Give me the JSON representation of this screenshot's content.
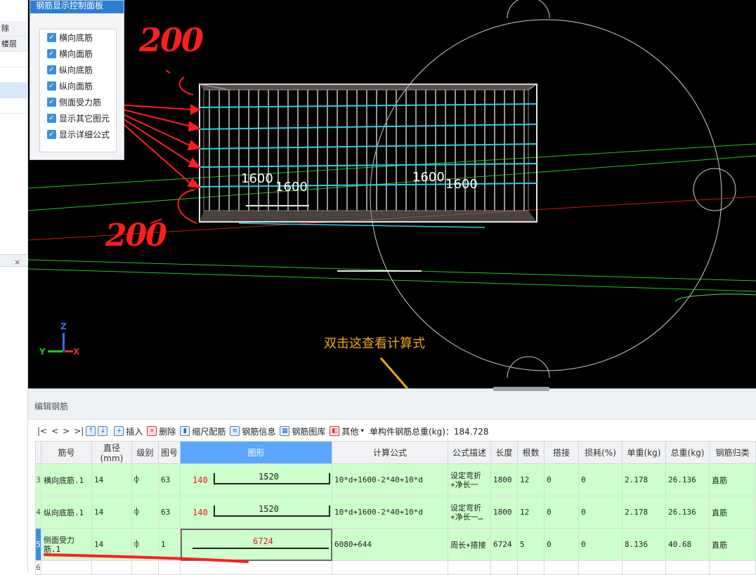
{
  "left_stub": {
    "rows": [
      "除",
      "楼层",
      "",
      "",
      "",
      ""
    ],
    "close_glyph": "×"
  },
  "control_panel": {
    "title": "钢筋显示控制面板",
    "items": [
      "横向底筋",
      "横向面筋",
      "纵向底筋",
      "纵向面筋",
      "侧面受力筋",
      "显示其它图元",
      "显示详细公式"
    ],
    "check_glyph": "✓"
  },
  "viewport": {
    "dim_labels": [
      "1600",
      "1600",
      "1600",
      "1600"
    ],
    "axes": {
      "z": "Z",
      "y": "Y",
      "x": "X"
    },
    "handwritten_top": "200",
    "handwritten_bottom": "200",
    "annotation": "双击这查看计算式"
  },
  "edit_panel": {
    "title": "编辑钢筋",
    "toolbar": {
      "nav": [
        "|<",
        "<",
        ">",
        ">|"
      ],
      "buttons": [
        "插入",
        "删除",
        "缩尺配筋",
        "钢筋信息",
        "钢筋图库",
        "其他"
      ],
      "dropdown_glyph": "▾",
      "total_weight": "单构件钢筋总重(kg)：184.728"
    },
    "columns": [
      "筋号",
      "直径(mm)",
      "级别",
      "图号",
      "图形",
      "计算公式",
      "公式描述",
      "长度",
      "根数",
      "搭接",
      "损耗(%)",
      "单重(kg)",
      "总重(kg)",
      "钢筋归类"
    ],
    "rows": [
      {
        "num": "3",
        "name": "横向底筋.1",
        "dia": "14",
        "grade": "⌽",
        "fig": "63",
        "shape_left": "140",
        "shape_mid": "1520",
        "formula": "10*d+1600-2*40+10*d",
        "desc": "设定弯折+净长一",
        "length": "1800",
        "count": "12",
        "lap": "0",
        "loss": "0",
        "unit_wt": "2.178",
        "total_wt": "26.136",
        "category": "直筋"
      },
      {
        "num": "4",
        "name": "纵向底筋.1",
        "dia": "14",
        "grade": "⌽",
        "fig": "63",
        "shape_left": "140",
        "shape_mid": "1520",
        "formula": "10*d+1600-2*40+10*d",
        "desc": "设定弯折+净长一…",
        "length": "1800",
        "count": "12",
        "lap": "0",
        "loss": "0",
        "unit_wt": "2.178",
        "total_wt": "26.136",
        "category": "直筋"
      },
      {
        "num": "5",
        "name": "侧面受力筋.1",
        "dia": "14",
        "grade": "⌽",
        "fig": "1",
        "shape_mid": "6724",
        "formula": "6080+644",
        "desc": "周长+搭接",
        "length": "6724",
        "count": "5",
        "lap": "0",
        "loss": "0",
        "unit_wt": "8.136",
        "total_wt": "40.68",
        "category": "直筋"
      }
    ],
    "empty_row_num": "6"
  },
  "colors": {
    "viewport_bg": "#000000",
    "panel_title": "#2a7fd4",
    "row_green": "#ccffcc",
    "annotation_red": "#ff1e1e",
    "annotation_orange": "#f0a81e",
    "rebar_cyan": "#22d3e6"
  }
}
